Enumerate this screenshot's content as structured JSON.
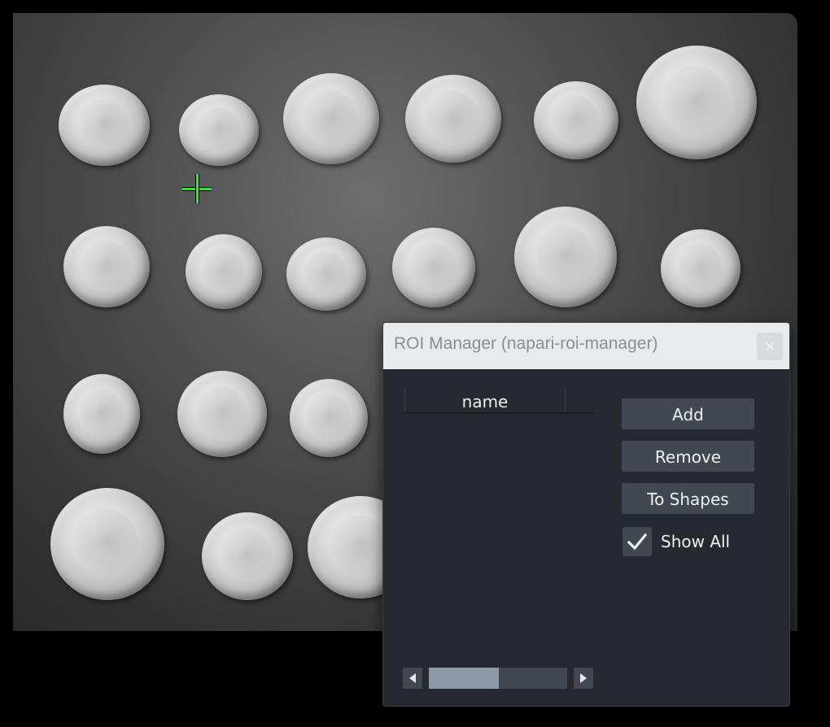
{
  "viewer": {
    "image_description_icon": "coins-image",
    "cursor_icon": "crosshair-icon",
    "cursor_color": "#2eea2e"
  },
  "roi_dialog": {
    "title": "ROI Manager (napari-roi-manager)",
    "close_symbol": "×",
    "table": {
      "columns": [
        "name"
      ],
      "rows": []
    },
    "buttons": {
      "add_label": "Add",
      "remove_label": "Remove",
      "to_shapes_label": "To Shapes"
    },
    "show_all": {
      "label": "Show All",
      "checked": true
    },
    "colors": {
      "panel_bg": "#262930",
      "button_bg": "#414851",
      "title_bg": "#e9eaec",
      "scroll_thumb": "#8d99a6"
    }
  }
}
